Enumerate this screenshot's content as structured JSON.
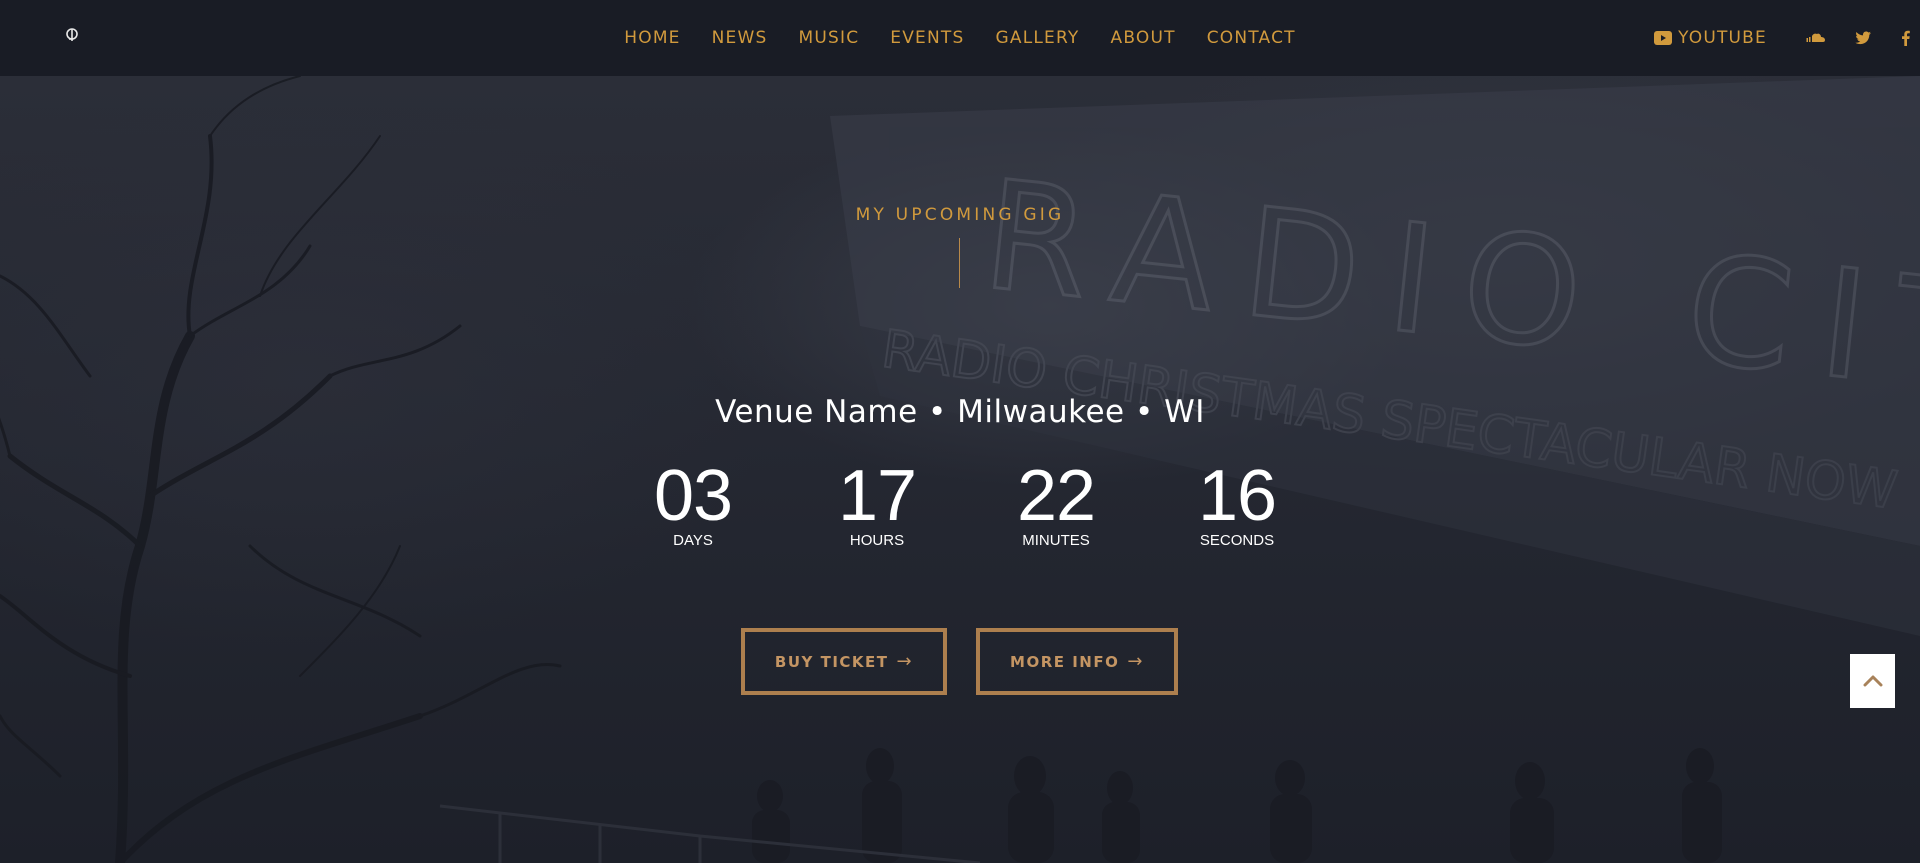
{
  "nav": {
    "items": [
      {
        "label": "HOME"
      },
      {
        "label": "NEWS"
      },
      {
        "label": "MUSIC"
      },
      {
        "label": "EVENTS"
      },
      {
        "label": "GALLERY"
      },
      {
        "label": "ABOUT"
      },
      {
        "label": "CONTACT"
      }
    ]
  },
  "social": {
    "youtube_label": "YOUTUBE",
    "icons": [
      "youtube-icon",
      "soundcloud-icon",
      "twitter-icon",
      "facebook-icon"
    ]
  },
  "hero": {
    "eyebrow": "MY UPCOMING GIG",
    "venue": "Venue Name • Milwaukee • WI",
    "background_signage": "RADIO CITY · CHRISTMAS SPECTACULAR NOW",
    "countdown": [
      {
        "value": "03",
        "label": "DAYS"
      },
      {
        "value": "17",
        "label": "HOURS"
      },
      {
        "value": "22",
        "label": "MINUTES"
      },
      {
        "value": "16",
        "label": "SECONDS"
      }
    ],
    "buttons": {
      "buy_ticket": "BUY TICKET",
      "more_info": "MORE INFO",
      "arrow": "→"
    }
  },
  "colors": {
    "accent": "#d19a3d",
    "button_border": "#ad7f4e",
    "header_bg": "#191c25",
    "hero_bg": "#1e2029",
    "text": "#ffffff"
  }
}
